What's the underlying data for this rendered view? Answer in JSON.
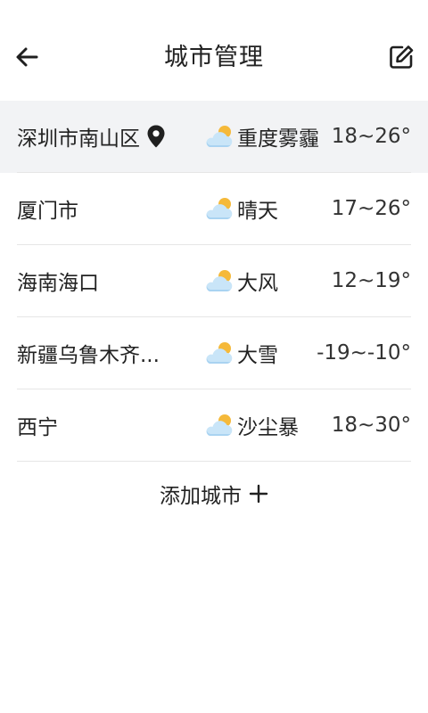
{
  "header": {
    "title": "城市管理",
    "back_icon": "arrow-left-icon",
    "edit_icon": "edit-icon"
  },
  "cities": [
    {
      "name": "深圳市南山区",
      "is_current_location": true,
      "weather": "重度雾霾",
      "weather_icon": "cloud-sun-icon",
      "temp": "18~26°"
    },
    {
      "name": "厦门市",
      "is_current_location": false,
      "weather": "晴天",
      "weather_icon": "cloud-sun-icon",
      "temp": "17~26°"
    },
    {
      "name": "海南海口",
      "is_current_location": false,
      "weather": "大风",
      "weather_icon": "cloud-sun-icon",
      "temp": "12~19°"
    },
    {
      "name": "新疆乌鲁木齐...",
      "is_current_location": false,
      "weather": "大雪",
      "weather_icon": "cloud-sun-icon",
      "temp": "-19~-10°"
    },
    {
      "name": "西宁",
      "is_current_location": false,
      "weather": "沙尘暴",
      "weather_icon": "cloud-sun-icon",
      "temp": "18~30°"
    }
  ],
  "add_city": {
    "label": "添加城市",
    "icon": "plus-icon"
  },
  "colors": {
    "active_row_bg": "#f2f3f5",
    "divider": "#e6e6e6",
    "text": "#222222",
    "sun": "#f5b93a",
    "cloud": "#bfe0f7"
  }
}
